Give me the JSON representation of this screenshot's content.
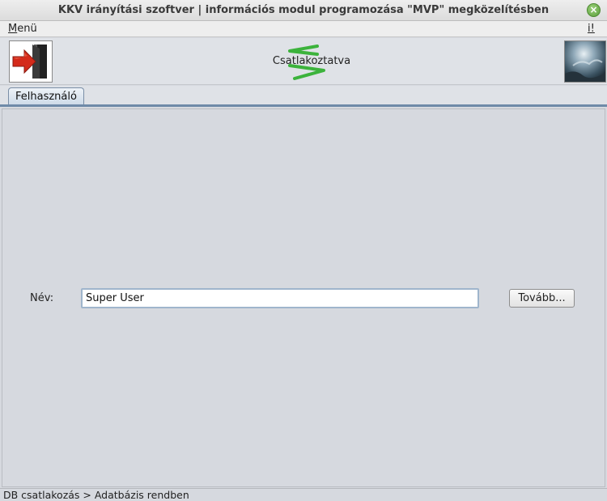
{
  "window": {
    "title": "KKV irányítási szoftver | információs modul programozása \"MVP\" megközelítésben",
    "close_glyph": "⊗"
  },
  "menubar": {
    "menu_label": "Menü",
    "info_label": "i!"
  },
  "toolbar": {
    "exit_icon": "exit-door-icon",
    "connection_status": "Csatlakoztatva",
    "connection_icon": "connection-arrows-icon",
    "connection_color": "#3cb33c",
    "user_icon": "user-avatar-icon"
  },
  "tabs": [
    {
      "label": "Felhasználó",
      "active": true
    }
  ],
  "form": {
    "name_label": "Név:",
    "name_value": "Super User",
    "next_button": "Tovább..."
  },
  "statusbar": {
    "text": "DB csatlakozás >  Adatbázis rendben"
  }
}
